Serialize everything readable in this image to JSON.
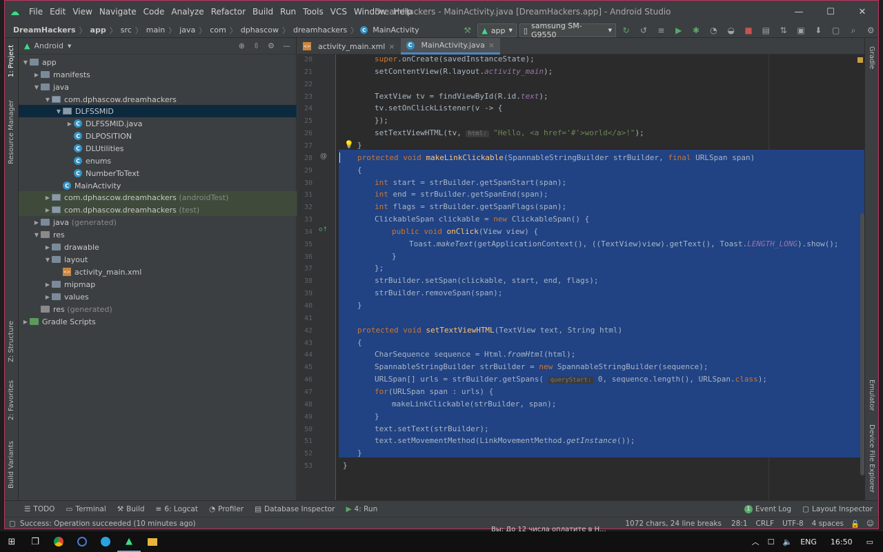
{
  "window": {
    "title": "DreamHackers - MainActivity.java [DreamHackers.app] - Android Studio"
  },
  "menu": [
    "File",
    "Edit",
    "View",
    "Navigate",
    "Code",
    "Analyze",
    "Refactor",
    "Build",
    "Run",
    "Tools",
    "VCS",
    "Window",
    "Help"
  ],
  "breadcrumbs": [
    "DreamHackers",
    "app",
    "src",
    "main",
    "java",
    "com",
    "dphascow",
    "dreamhackers",
    "MainActivity"
  ],
  "run_config": "app",
  "device": "samsung SM-G9550",
  "left_tools": [
    "1: Project",
    "Resource Manager",
    "Z: Structure",
    "2: Favorites",
    "Build Variants"
  ],
  "right_tools": [
    "Gradle",
    "Emulator",
    "Device File Explorer"
  ],
  "project_view": "Android",
  "tree": [
    {
      "label": "app",
      "suffix": ""
    },
    {
      "label": "manifests",
      "suffix": ""
    },
    {
      "label": "java",
      "suffix": ""
    },
    {
      "label": "com.dphascow.dreamhackers",
      "suffix": ""
    },
    {
      "label": "DLFSSMID",
      "suffix": ""
    },
    {
      "label": "DLFSSMID.java",
      "suffix": ""
    },
    {
      "label": "DLPOSITION",
      "suffix": ""
    },
    {
      "label": "DLUtilities",
      "suffix": ""
    },
    {
      "label": "enums",
      "suffix": ""
    },
    {
      "label": "NumberToText",
      "suffix": ""
    },
    {
      "label": "MainActivity",
      "suffix": ""
    },
    {
      "label": "com.dphascow.dreamhackers",
      "suffix": "(androidTest)"
    },
    {
      "label": "com.dphascow.dreamhackers",
      "suffix": "(test)"
    },
    {
      "label": "java",
      "suffix": "(generated)"
    },
    {
      "label": "res",
      "suffix": ""
    },
    {
      "label": "drawable",
      "suffix": ""
    },
    {
      "label": "layout",
      "suffix": ""
    },
    {
      "label": "activity_main.xml",
      "suffix": ""
    },
    {
      "label": "mipmap",
      "suffix": ""
    },
    {
      "label": "values",
      "suffix": ""
    },
    {
      "label": "res",
      "suffix": "(generated)"
    },
    {
      "label": "Gradle Scripts",
      "suffix": ""
    }
  ],
  "tabs": [
    {
      "label": "activity_main.xml"
    },
    {
      "label": "MainActivity.java"
    }
  ],
  "line_numbers": [
    "20",
    "21",
    "22",
    "23",
    "24",
    "25",
    "26",
    "27",
    "28",
    "29",
    "30",
    "31",
    "32",
    "33",
    "34",
    "35",
    "36",
    "37",
    "38",
    "39",
    "40",
    "41",
    "42",
    "43",
    "44",
    "45",
    "46",
    "47",
    "48",
    "49",
    "50",
    "51",
    "52",
    "53"
  ],
  "hints": {
    "html": "html:",
    "query": "queryStart:"
  },
  "bottom_tools": [
    "TODO",
    "Terminal",
    "Build",
    "6: Logcat",
    "Profiler",
    "Database Inspector",
    "4: Run"
  ],
  "bottom_right_tools": [
    "Event Log",
    "Layout Inspector"
  ],
  "event_count": "1",
  "status": {
    "message": "Success: Operation succeeded (10 minutes ago)",
    "chars": "1072 chars, 24 line breaks",
    "position": "28:1",
    "line_sep": "CRLF",
    "encoding": "UTF-8",
    "indent": "4 spaces"
  },
  "taskbar": {
    "lang": "ENG",
    "time": "16:50",
    "behind_text": "Вы: До 12 числа оплатите в Н..."
  }
}
